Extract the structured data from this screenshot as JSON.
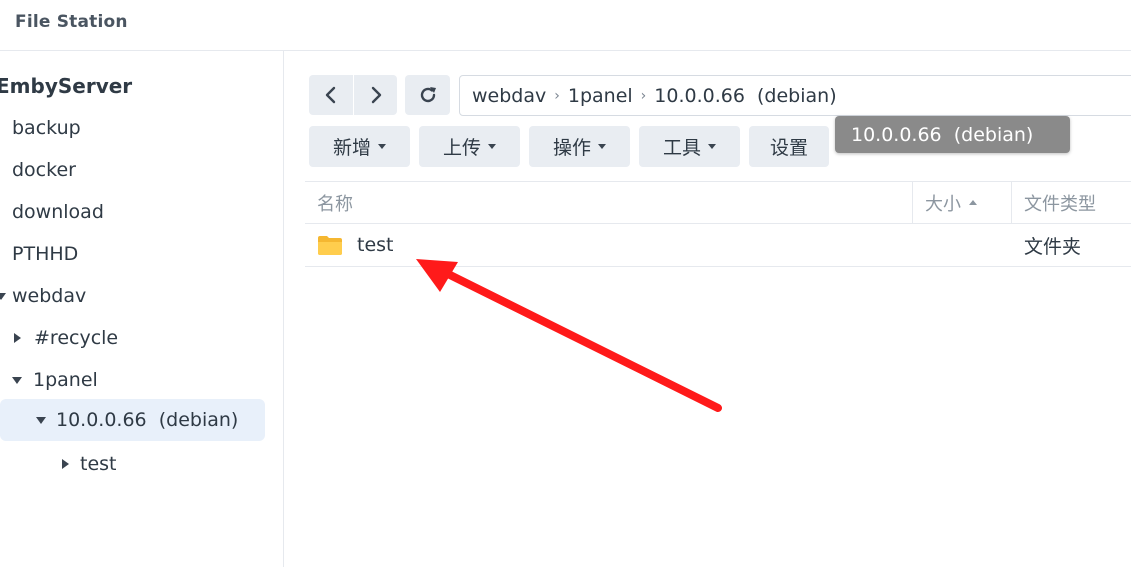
{
  "app": {
    "title": "File Station"
  },
  "sidebar": {
    "root": "EmbyServer",
    "items": [
      {
        "label": "backup"
      },
      {
        "label": "docker"
      },
      {
        "label": "download"
      },
      {
        "label": "PTHHD"
      },
      {
        "label": "webdav",
        "expanded": true
      },
      {
        "label": "#recycle",
        "expanded": false
      },
      {
        "label": "1panel",
        "expanded": true
      },
      {
        "label": "10.0.0.66  (debian)",
        "expanded": true,
        "selected": true
      },
      {
        "label": "test",
        "expanded": false
      }
    ]
  },
  "toolbar": {
    "back_icon": "chevron-left-icon",
    "forward_icon": "chevron-right-icon",
    "refresh_icon": "refresh-icon",
    "path": [
      "webdav",
      "1panel",
      "10.0.0.66  (debian)"
    ],
    "buttons": {
      "create": "新增",
      "upload": "上传",
      "action": "操作",
      "tools": "工具",
      "settings": "设置"
    }
  },
  "tooltip": {
    "text": "10.0.0.66  (debian)"
  },
  "table": {
    "columns": {
      "name": "名称",
      "size": "大小",
      "type": "文件类型"
    },
    "rows": [
      {
        "name": "test",
        "size": "",
        "type": "文件夹",
        "icon": "folder-icon"
      }
    ]
  },
  "annotation": {
    "color": "#ff1a1a",
    "shape": "arrow"
  },
  "colors": {
    "selected_bg": "#e8f0fa",
    "button_bg": "#e9edf2",
    "folder": "#ffc94a",
    "tooltip_bg": "#8a8a8a"
  }
}
